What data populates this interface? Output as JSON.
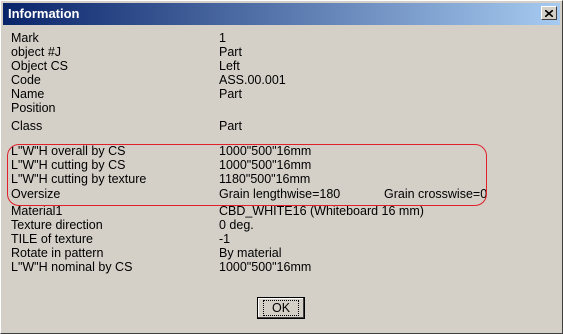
{
  "window": {
    "title": "Information"
  },
  "rows": [
    {
      "label": "Mark",
      "value": "1",
      "value2": ""
    },
    {
      "label": "object #J",
      "value": "Part",
      "value2": ""
    },
    {
      "label": "Object CS",
      "value": "Left",
      "value2": ""
    },
    {
      "label": "Code",
      "value": "ASS.00.001",
      "value2": ""
    },
    {
      "label": "Name",
      "value": "Part",
      "value2": ""
    },
    {
      "label": "Position",
      "value": "",
      "value2": ""
    },
    {
      "label": "Class",
      "value": "Part",
      "value2": ""
    },
    {
      "label": "L\"W\"H overall by CS",
      "value": "1000\"500\"16mm",
      "value2": ""
    },
    {
      "label": "L\"W\"H cutting by CS",
      "value": "1000\"500\"16mm",
      "value2": ""
    },
    {
      "label": "L\"W\"H cutting by texture",
      "value": "1180\"500\"16mm",
      "value2": ""
    },
    {
      "label": "Oversize",
      "value": "Grain lengthwise=180",
      "value2": "Grain crosswise=0"
    },
    {
      "label": "Material1",
      "value": "CBD_WHITE16 (Whiteboard 16 mm)",
      "value2": ""
    },
    {
      "label": "Texture direction",
      "value": "0 deg.",
      "value2": ""
    },
    {
      "label": "TILE of texture",
      "value": "-1",
      "value2": ""
    },
    {
      "label": "Rotate in pattern",
      "value": "By material",
      "value2": ""
    },
    {
      "label": "L\"W\"H nominal by CS",
      "value": "1000\"500\"16mm",
      "value2": ""
    }
  ],
  "buttons": {
    "ok": "OK",
    "close_icon": "close-icon"
  },
  "colors": {
    "titlebar_start": "#0a246a",
    "titlebar_end": "#a6caf0",
    "highlight": "#e0202a",
    "face": "#d4d0c8"
  }
}
